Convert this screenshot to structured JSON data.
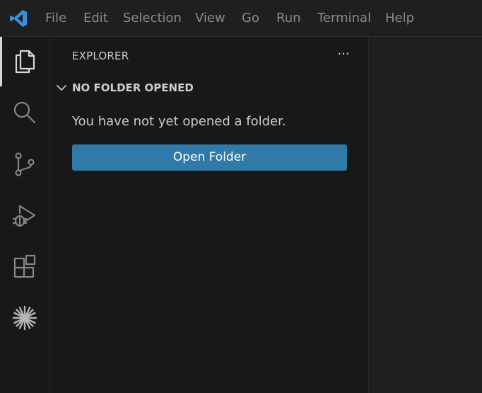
{
  "menu": [
    "File",
    "Edit",
    "Selection",
    "View",
    "Go",
    "Run",
    "Terminal",
    "Help"
  ],
  "activity_bar": {
    "items": [
      {
        "icon": "files-icon",
        "active": true
      },
      {
        "icon": "search-icon",
        "active": false
      },
      {
        "icon": "source-control-icon",
        "active": false
      },
      {
        "icon": "run-debug-icon",
        "active": false
      },
      {
        "icon": "extensions-icon",
        "active": false
      },
      {
        "icon": "sparkle-icon",
        "active": false
      }
    ]
  },
  "sidebar": {
    "title": "EXPLORER",
    "more_label": "···",
    "section": {
      "title": "NO FOLDER OPENED",
      "message": "You have not yet opened a folder.",
      "button_label": "Open Folder"
    }
  },
  "colors": {
    "accent_button": "#2f7aa8",
    "logo_blue": "#3a8fd8",
    "background": "#1f1f1f",
    "sidebar_background": "#181818"
  }
}
